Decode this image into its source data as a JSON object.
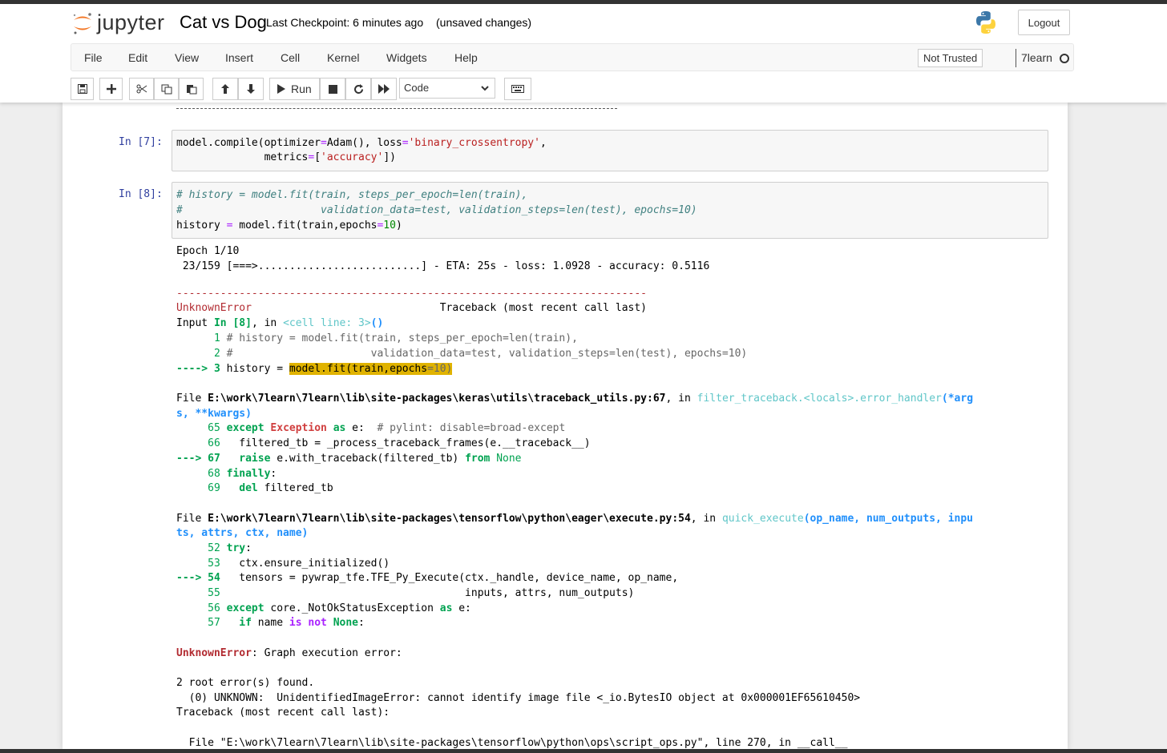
{
  "header": {
    "logo_text": "jupyter",
    "notebook_title": "Cat vs Dog",
    "checkpoint": "Last Checkpoint: 6 minutes ago",
    "unsaved": "(unsaved changes)",
    "logout_label": "Logout"
  },
  "menubar": {
    "items": [
      "File",
      "Edit",
      "View",
      "Insert",
      "Cell",
      "Kernel",
      "Widgets",
      "Help"
    ],
    "trust": "Not Trusted",
    "kernel": "7learn"
  },
  "toolbar": {
    "run_label": "Run",
    "cell_type": "Code"
  },
  "cells": {
    "c7": {
      "prompt": "In [7]:",
      "l1_a": "model.compile(optimizer",
      "l1_eq": "=",
      "l1_b": "Adam(), loss",
      "l1_eq2": "=",
      "l1_str": "'binary_crossentropy'",
      "l1_c": ",",
      "l2_a": "              metrics",
      "l2_eq": "=",
      "l2_b": "[",
      "l2_str": "'accuracy'",
      "l2_c": "])"
    },
    "c8": {
      "prompt": "In [8]:",
      "l1": "# history = model.fit(train, steps_per_epoch=len(train),",
      "l2": "#                      validation_data=test, validation_steps=len(test), epochs=10)",
      "l3_a": "history ",
      "l3_eq": "=",
      "l3_b": " model.fit(train,epochs",
      "l3_eq2": "=",
      "l3_num": "10",
      "l3_c": ")"
    }
  },
  "output": {
    "epoch": "Epoch 1/10",
    "progress": " 23/159 [===>..........................] - ETA: 25s - loss: 1.0928 - accuracy: 0.5116",
    "dashes": "---------------------------------------------------------------------------",
    "err_name": "UnknownError",
    "traceback_head": "                              Traceback (most recent call last)",
    "input_a": "Input ",
    "input_in": "In [8]",
    "input_b": ", in ",
    "input_cell": "<cell line: 3>",
    "input_paren": "()",
    "tb1_num": "      1",
    "tb1_txt": " # history = model.fit(train, steps_per_epoch=len(train),",
    "tb2_num": "      2",
    "tb2_txt": " #                      validation_data=test, validation_steps=len(test), epochs=10)",
    "tb3_arrow": "----> 3",
    "tb3_a": " history = ",
    "tb3_hl_a": "model.fit(train,epochs",
    "tb3_hl_b": "=10)",
    "file1_a": "File ",
    "file1_path": "E:\\work\\7learn\\7learn\\lib\\site-packages\\keras\\utils\\traceback_utils.py:67",
    "file1_b": ", in ",
    "file1_fn": "filter_traceback.<locals>.error_handler",
    "file1_args1": "(*arg",
    "file1_args2": "s, **kwargs)",
    "f1l65_num": "     65",
    "f1l65_a": " except",
    "f1l65_b": " Exception",
    "f1l65_c": " as",
    "f1l65_d": " e:  ",
    "f1l65_cm": "# pylint: disable=broad-except",
    "f1l66_num": "     66",
    "f1l66": "   filtered_tb = _process_traceback_frames(e.__traceback__)",
    "f1l67_arrow": "---> 67",
    "f1l67_a": "   raise",
    "f1l67_b": " e.with_traceback(filtered_tb) ",
    "f1l67_c": "from",
    "f1l67_d": " None",
    "f1l68_num": "     68",
    "f1l68_a": " finally",
    "f1l68_b": ":",
    "f1l69_num": "     69",
    "f1l69_a": "   del",
    "f1l69_b": " filtered_tb",
    "file2_a": "File ",
    "file2_path": "E:\\work\\7learn\\7learn\\lib\\site-packages\\tensorflow\\python\\eager\\execute.py:54",
    "file2_b": ", in ",
    "file2_fn": "quick_execute",
    "file2_args1": "(op_name, num_outputs, inpu",
    "file2_args2": "ts, attrs, ctx, name)",
    "f2l52_num": "     52",
    "f2l52_a": " try",
    "f2l52_b": ":",
    "f2l53_num": "     53",
    "f2l53": "   ctx.ensure_initialized()",
    "f2l54_arrow": "---> 54",
    "f2l54": "   tensors = pywrap_tfe.TFE_Py_Execute(ctx._handle, device_name, op_name,",
    "f2l55_num": "     55",
    "f2l55": "                                       inputs, attrs, num_outputs)",
    "f2l56_num": "     56",
    "f2l56_a": " except",
    "f2l56_b": " core._NotOkStatusException ",
    "f2l56_c": "as",
    "f2l56_d": " e:",
    "f2l57_num": "     57",
    "f2l57_a": "   if",
    "f2l57_b": " name ",
    "f2l57_c": "is not",
    "f2l57_d": " None",
    "f2l57_e": ":",
    "final_err": "UnknownError",
    "final_msg": ": Graph execution error:",
    "root_errors": "2 root error(s) found.",
    "unknown_line": "  (0) UNKNOWN:  UnidentifiedImageError: cannot identify image file <_io.BytesIO object at 0x000001EF65610450>",
    "traceback2": "Traceback (most recent call last):",
    "file3": "  File \"E:\\work\\7learn\\7learn\\lib\\site-packages\\tensorflow\\python\\ops\\script_ops.py\", line 270, in __call__"
  }
}
